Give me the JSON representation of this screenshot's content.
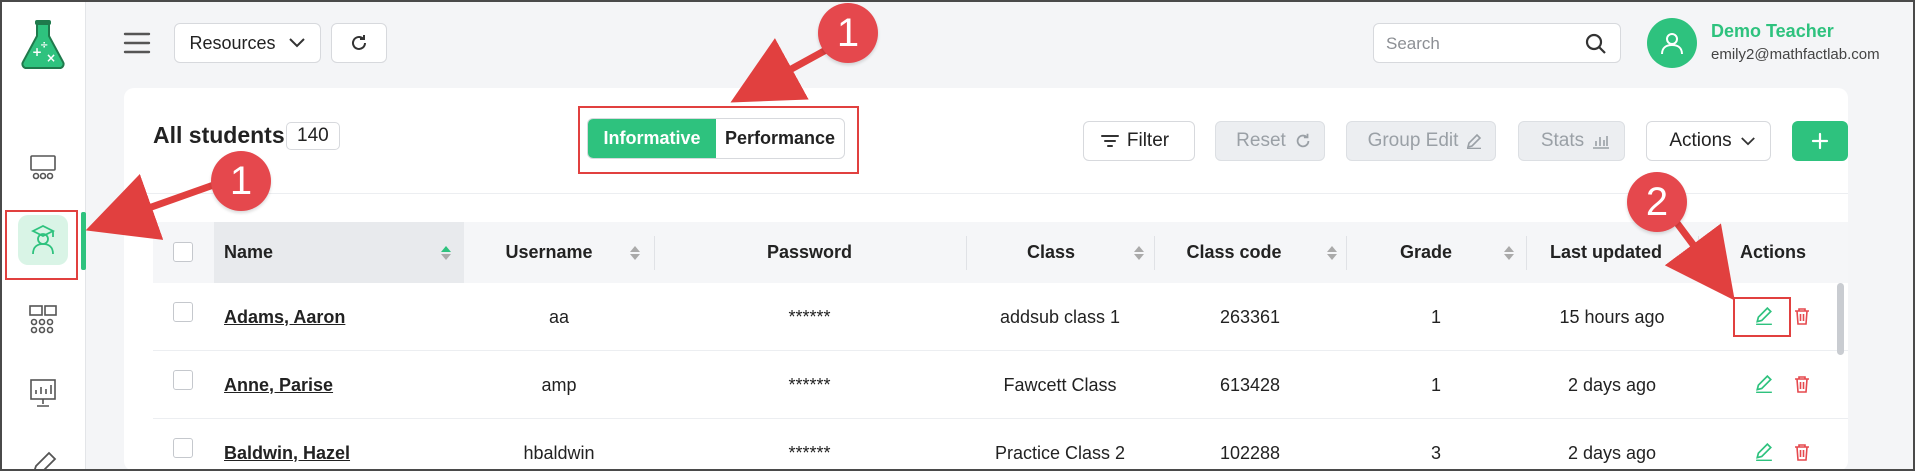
{
  "topbar": {
    "resources_label": "Resources",
    "search_placeholder": "Search"
  },
  "user": {
    "name": "Demo Teacher",
    "email": "emily2@mathfactlab.com"
  },
  "students": {
    "title": "All students",
    "count": "140"
  },
  "view_toggle": {
    "informative_label": "Informative",
    "performance_label": "Performance",
    "active": "Informative"
  },
  "toolbar": {
    "filter_label": "Filter",
    "reset_label": "Reset",
    "group_edit_label": "Group Edit",
    "stats_label": "Stats",
    "actions_label": "Actions"
  },
  "table": {
    "columns": {
      "name": "Name",
      "username": "Username",
      "password": "Password",
      "class": "Class",
      "class_code": "Class code",
      "grade": "Grade",
      "last_updated": "Last updated",
      "actions": "Actions"
    },
    "rows": [
      {
        "name": "Adams, Aaron",
        "username": "aa",
        "password": "******",
        "class": "addsub class 1",
        "class_code": "263361",
        "grade": "1",
        "last_updated": "15 hours ago"
      },
      {
        "name": "Anne, Parise",
        "username": "amp",
        "password": "******",
        "class": "Fawcett Class",
        "class_code": "613428",
        "grade": "1",
        "last_updated": "2 days ago"
      },
      {
        "name": "Baldwin, Hazel",
        "username": "hbaldwin",
        "password": "******",
        "class": "Practice Class 2",
        "class_code": "102288",
        "grade": "3",
        "last_updated": "2 days ago"
      }
    ]
  },
  "annotations": {
    "badge_1": "1",
    "badge_2": "2"
  },
  "colors": {
    "accent_green": "#2ec27e",
    "annotation_red": "#e1403f",
    "delete_red": "#e5484d"
  }
}
